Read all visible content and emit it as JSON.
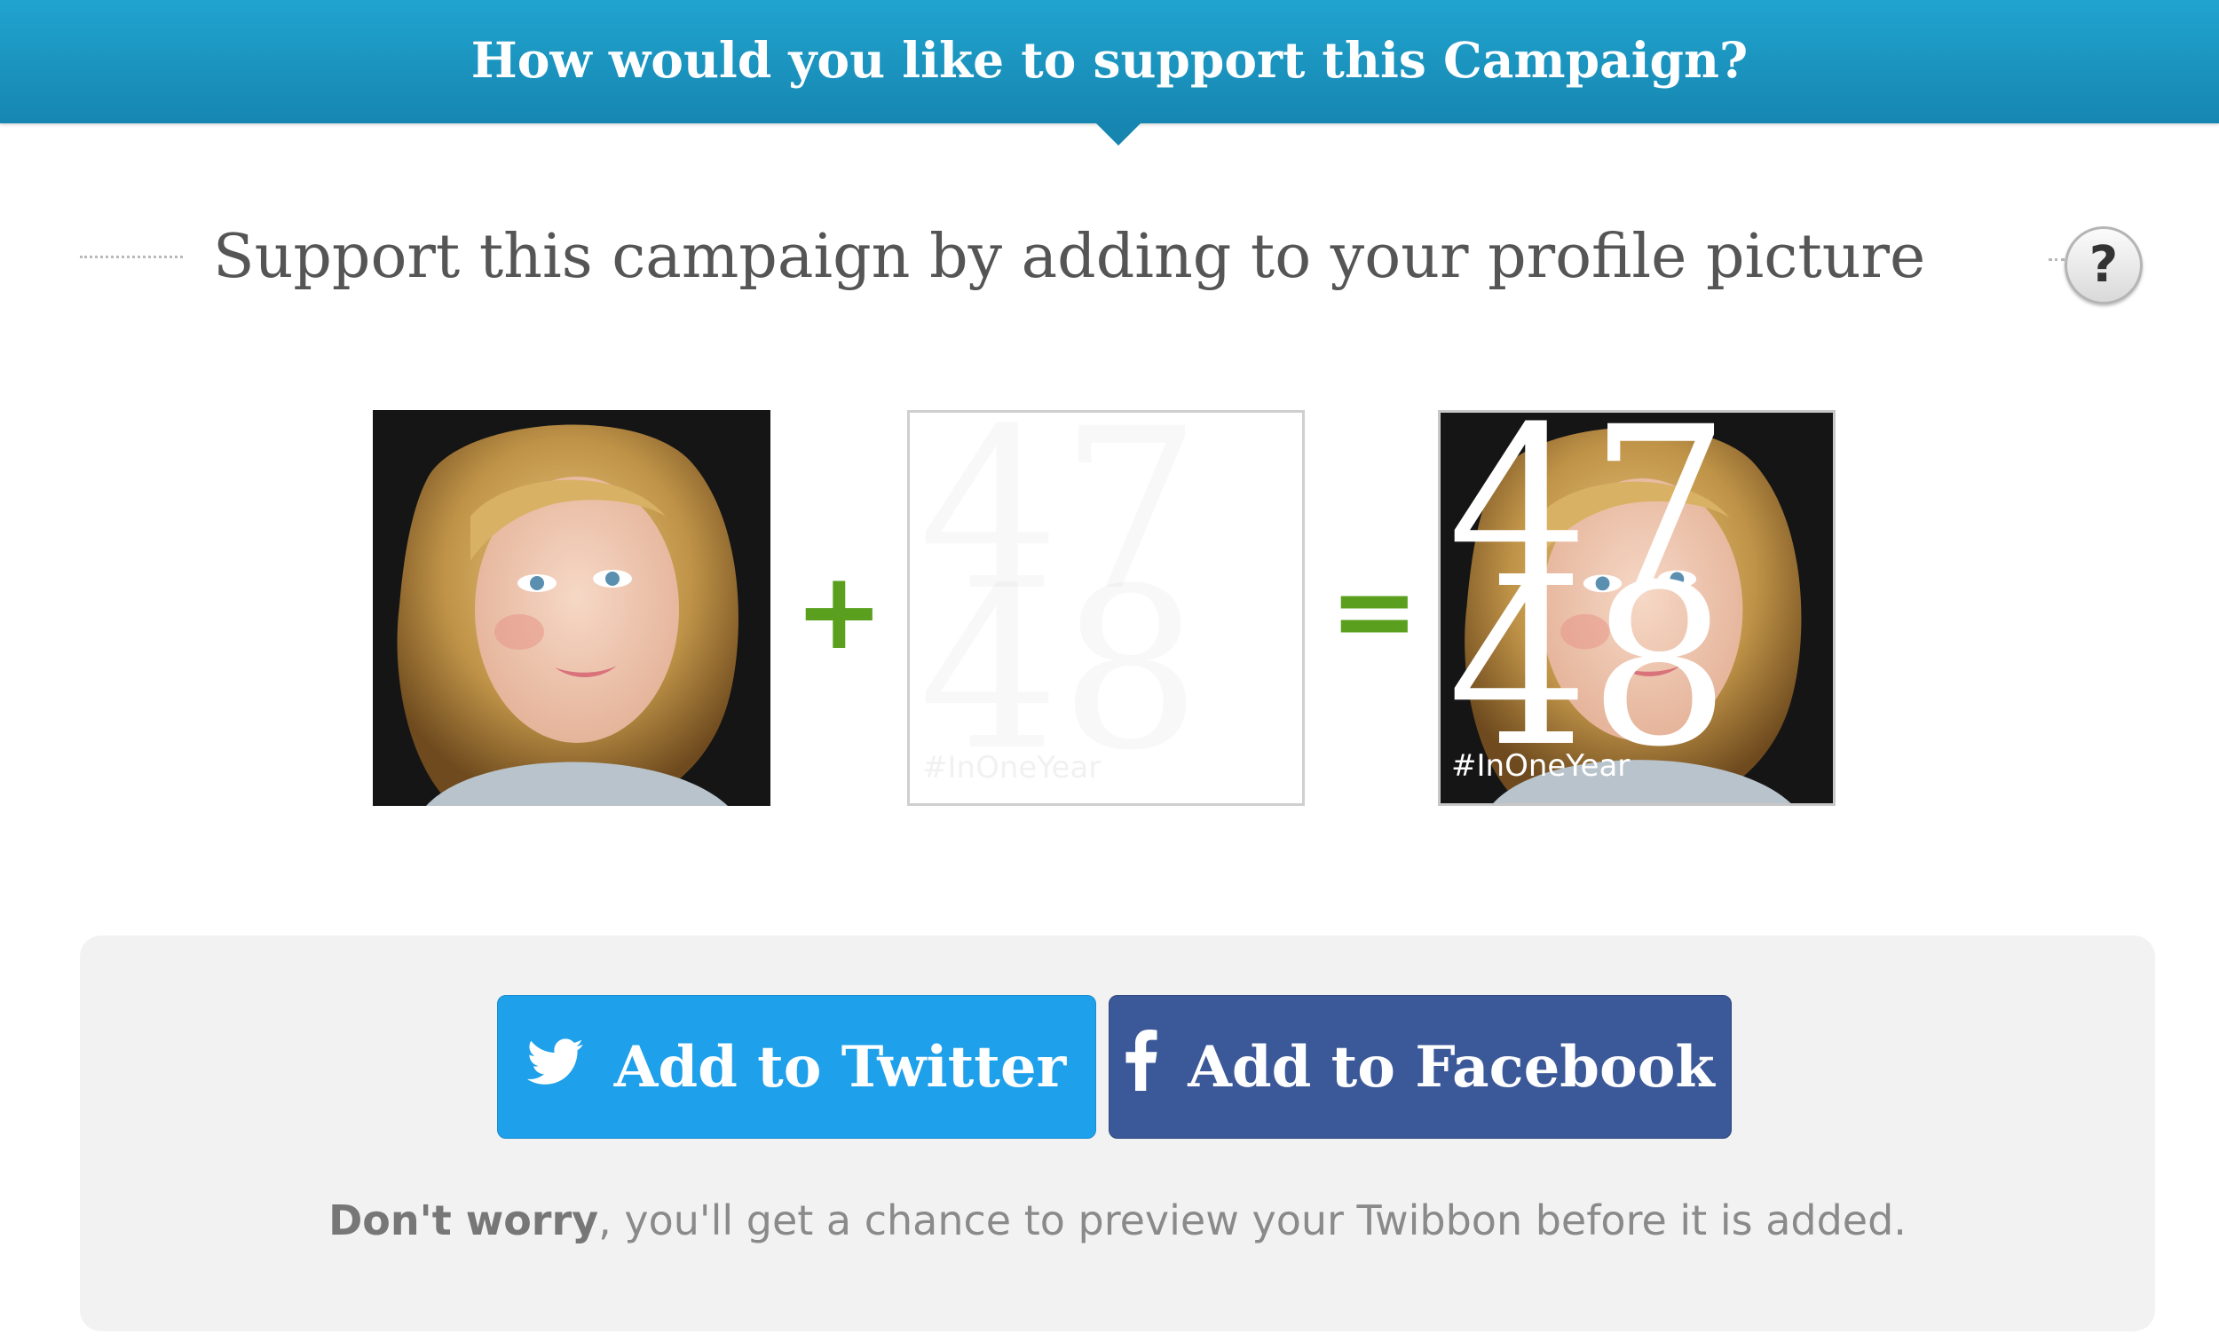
{
  "banner": {
    "title": "How would you like to support this Campaign?",
    "color": "#1a94c2"
  },
  "section": {
    "heading": "Support this campaign by adding to your profile picture",
    "help_label": "?"
  },
  "composer": {
    "plus_symbol": "+",
    "equals_symbol": "=",
    "operator_color": "#5aa01e",
    "overlay": {
      "line1": "47",
      "line2": "48",
      "hashtag": "#InOneYear"
    }
  },
  "actions": {
    "twitter_label": "Add to Twitter",
    "twitter_color": "#1fa0ea",
    "twitter_icon": "twitter-bird-icon",
    "facebook_label": "Add to Facebook",
    "facebook_color": "#3b5898",
    "facebook_icon": "facebook-f-icon",
    "note_strong": "Don't worry",
    "note_rest": ", you'll get a chance to preview your Twibbon before it is added."
  }
}
